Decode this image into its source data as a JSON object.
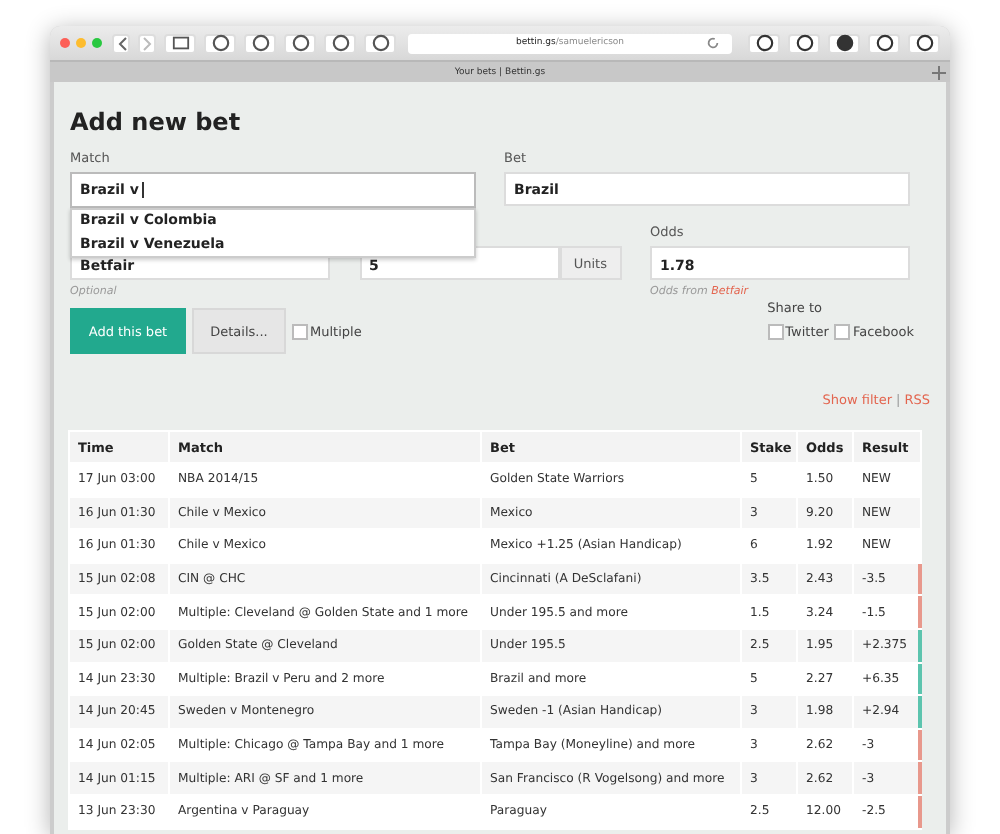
{
  "browser": {
    "url_host": "bettin.gs",
    "url_path": "/samuelericson",
    "tab_title": "Your bets | Bettin.gs"
  },
  "form": {
    "title": "Add new bet",
    "match": {
      "label": "Match",
      "value": "Brazil v",
      "suggestions": [
        "Brazil v Colombia",
        "Brazil v Venezuela"
      ]
    },
    "bet": {
      "label": "Bet",
      "value": "Brazil"
    },
    "bookmaker": {
      "value": "Betfair",
      "hint": "Optional"
    },
    "stake": {
      "value": "5",
      "addon": "Units"
    },
    "odds": {
      "label": "Odds",
      "value": "1.78",
      "hint": "Odds from",
      "hint_link": "Betfair"
    },
    "add_button": "Add this bet",
    "details_button": "Details...",
    "multiple": {
      "label": "Multiple",
      "checked": false
    },
    "share": {
      "label": "Share to",
      "options": [
        {
          "label": "Twitter",
          "checked": false
        },
        {
          "label": "Facebook",
          "checked": false
        }
      ]
    }
  },
  "links": {
    "items": [
      "Show filter",
      "RSS"
    ],
    "separator": "|"
  },
  "table": {
    "columns": [
      "Time",
      "Match",
      "Bet",
      "Stake",
      "Odds",
      "Result"
    ],
    "rows": [
      {
        "cells": [
          "17 Jun 03:00",
          "NBA 2014/15",
          "Golden State Warriors",
          "5",
          "1.50",
          "NEW"
        ]
      },
      {
        "cells": [
          "16 Jun 01:30",
          "Chile v Mexico",
          "Mexico",
          "3",
          "9.20",
          "NEW"
        ]
      },
      {
        "cells": [
          "16 Jun 01:30",
          "Chile v Mexico",
          "Mexico +1.25 (Asian Handicap)",
          "6",
          "1.92",
          "NEW"
        ]
      },
      {
        "cells": [
          "15 Jun 02:08",
          "CIN @ CHC",
          "Cincinnati (A DeSclafani)",
          "3.5",
          "2.43",
          "-3.5"
        ],
        "color": "#e8988c"
      },
      {
        "cells": [
          "15 Jun 02:00",
          "Multiple: Cleveland @ Golden State and 1 more",
          "Under 195.5 and more",
          "1.5",
          "3.24",
          "-1.5"
        ],
        "color": "#e8988c"
      },
      {
        "cells": [
          "15 Jun 02:00",
          "Golden State @ Cleveland",
          "Under 195.5",
          "2.5",
          "1.95",
          "+2.375"
        ],
        "color": "#5cc4ae"
      },
      {
        "cells": [
          "14 Jun 23:30",
          "Multiple: Brazil v Peru and 2 more",
          "Brazil and more",
          "5",
          "2.27",
          "+6.35"
        ],
        "color": "#5cc4ae"
      },
      {
        "cells": [
          "14 Jun 20:45",
          "Sweden v Montenegro",
          "Sweden -1 (Asian Handicap)",
          "3",
          "1.98",
          "+2.94"
        ],
        "color": "#5cc4ae"
      },
      {
        "cells": [
          "14 Jun 02:05",
          "Multiple: Chicago @ Tampa Bay and 1 more",
          "Tampa Bay (Moneyline) and more",
          "3",
          "2.62",
          "-3"
        ],
        "color": "#e8988c"
      },
      {
        "cells": [
          "14 Jun 01:15",
          "Multiple: ARI @ SF and 1 more",
          "San Francisco (R Vogelsong) and more",
          "3",
          "2.62",
          "-3"
        ],
        "color": "#e8988c"
      },
      {
        "cells": [
          "13 Jun 23:30",
          "Argentina v Paraguay",
          "Paraguay",
          "2.5",
          "12.00",
          "-2.5"
        ],
        "color": "#e8988c"
      }
    ]
  }
}
